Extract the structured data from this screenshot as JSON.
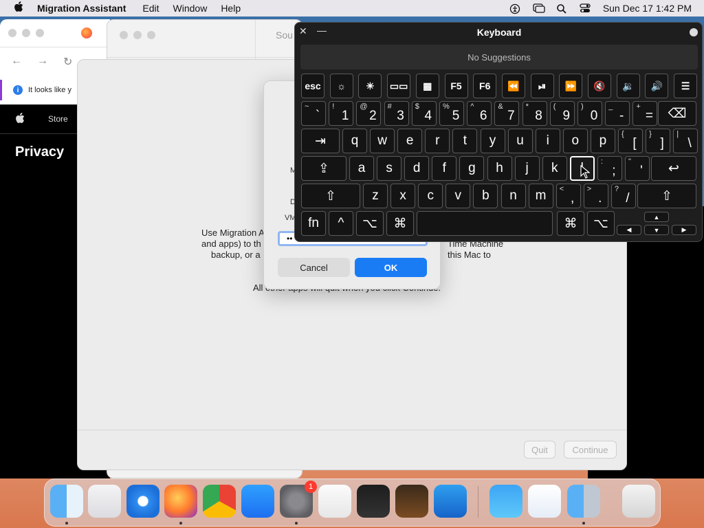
{
  "menubar": {
    "app_name": "Migration Assistant",
    "menus": [
      "Edit",
      "Window",
      "Help"
    ],
    "datetime": "Sun Dec 17  1:42 PM",
    "icons": [
      "apple-icon",
      "accessibility-icon",
      "screen-mirroring-icon",
      "search-icon",
      "control-center-icon"
    ]
  },
  "browser": {
    "info_text": "It looks like y",
    "store_label": "Store",
    "privacy_heading": "Privacy"
  },
  "settings": {
    "title_partial": "Sou"
  },
  "migration": {
    "left_text": [
      "Use Migration A",
      "and apps) to th",
      "backup, or a"
    ],
    "right_text": [
      "Time Machine",
      "this Mac to"
    ],
    "bottom_text": "All other apps will quit when you click Continue.",
    "quit_label": "Quit",
    "continue_label": "Continue"
  },
  "dialog": {
    "label_m": "M",
    "label_d": "D",
    "label_vm": "VM",
    "password_value": "••",
    "cancel_label": "Cancel",
    "ok_label": "OK"
  },
  "keyboard": {
    "title": "Keyboard",
    "suggestions": "No Suggestions",
    "fn_row": [
      "esc",
      "☼",
      "☀",
      "▭▭",
      "▦",
      "F5",
      "F6",
      "⏪",
      "⏯",
      "⏩",
      "🔇",
      "🔉",
      "🔊",
      "☰"
    ],
    "fn_row_names": [
      "esc-key",
      "brightness-down-icon",
      "brightness-up-icon",
      "mission-control-icon",
      "launchpad-icon",
      "f5-key",
      "f6-key",
      "rewind-icon",
      "play-pause-icon",
      "fast-forward-icon",
      "mute-icon",
      "volume-down-icon",
      "volume-up-icon",
      "list-icon"
    ],
    "number_row": [
      {
        "shift": "~",
        "main": "`"
      },
      {
        "shift": "!",
        "main": "1"
      },
      {
        "shift": "@",
        "main": "2"
      },
      {
        "shift": "#",
        "main": "3"
      },
      {
        "shift": "$",
        "main": "4"
      },
      {
        "shift": "%",
        "main": "5"
      },
      {
        "shift": "^",
        "main": "6"
      },
      {
        "shift": "&",
        "main": "7"
      },
      {
        "shift": "*",
        "main": "8"
      },
      {
        "shift": "(",
        "main": "9"
      },
      {
        "shift": ")",
        "main": "0"
      },
      {
        "shift": "_",
        "main": "-"
      },
      {
        "shift": "+",
        "main": "="
      }
    ],
    "delete": "⌫",
    "tab": "⇥",
    "qwerty_row": [
      "q",
      "w",
      "e",
      "r",
      "t",
      "y",
      "u",
      "i",
      "o",
      "p"
    ],
    "bracket_keys": [
      {
        "shift": "{",
        "main": "["
      },
      {
        "shift": "}",
        "main": "]"
      },
      {
        "shift": "|",
        "main": "\\"
      }
    ],
    "capslock": "⇪",
    "home_row": [
      "a",
      "s",
      "d",
      "f",
      "g",
      "h",
      "j",
      "k",
      "l"
    ],
    "semi_keys": [
      {
        "shift": ":",
        "main": ";"
      },
      {
        "shift": "\"",
        "main": "'"
      }
    ],
    "return": "↩",
    "shift": "⇧",
    "bottom_letters": [
      "z",
      "x",
      "c",
      "v",
      "b",
      "n",
      "m"
    ],
    "punct_keys": [
      {
        "shift": "<",
        "main": ","
      },
      {
        "shift": ">",
        "main": "."
      },
      {
        "shift": "?",
        "main": "/"
      }
    ],
    "fn": "fn",
    "ctrl": "^",
    "option": "⌥",
    "command": "⌘",
    "arrows": {
      "up": "▲",
      "down": "▼",
      "left": "◀",
      "right": "▶"
    }
  },
  "dock": {
    "apps": [
      "Finder",
      "Launchpad",
      "Safari",
      "Firefox",
      "Chrome",
      "App Store",
      "System Settings",
      "TextEdit",
      "Terminal",
      "GarageBand",
      "Visual Studio Code",
      "Weather",
      "Keynote",
      "Migration Assistant",
      "Trash"
    ],
    "settings_badge": "1"
  },
  "colors": {
    "accent": "#1a7cf5",
    "keyboard_bg": "#1e1e1e",
    "badge": "#ff3b30"
  }
}
